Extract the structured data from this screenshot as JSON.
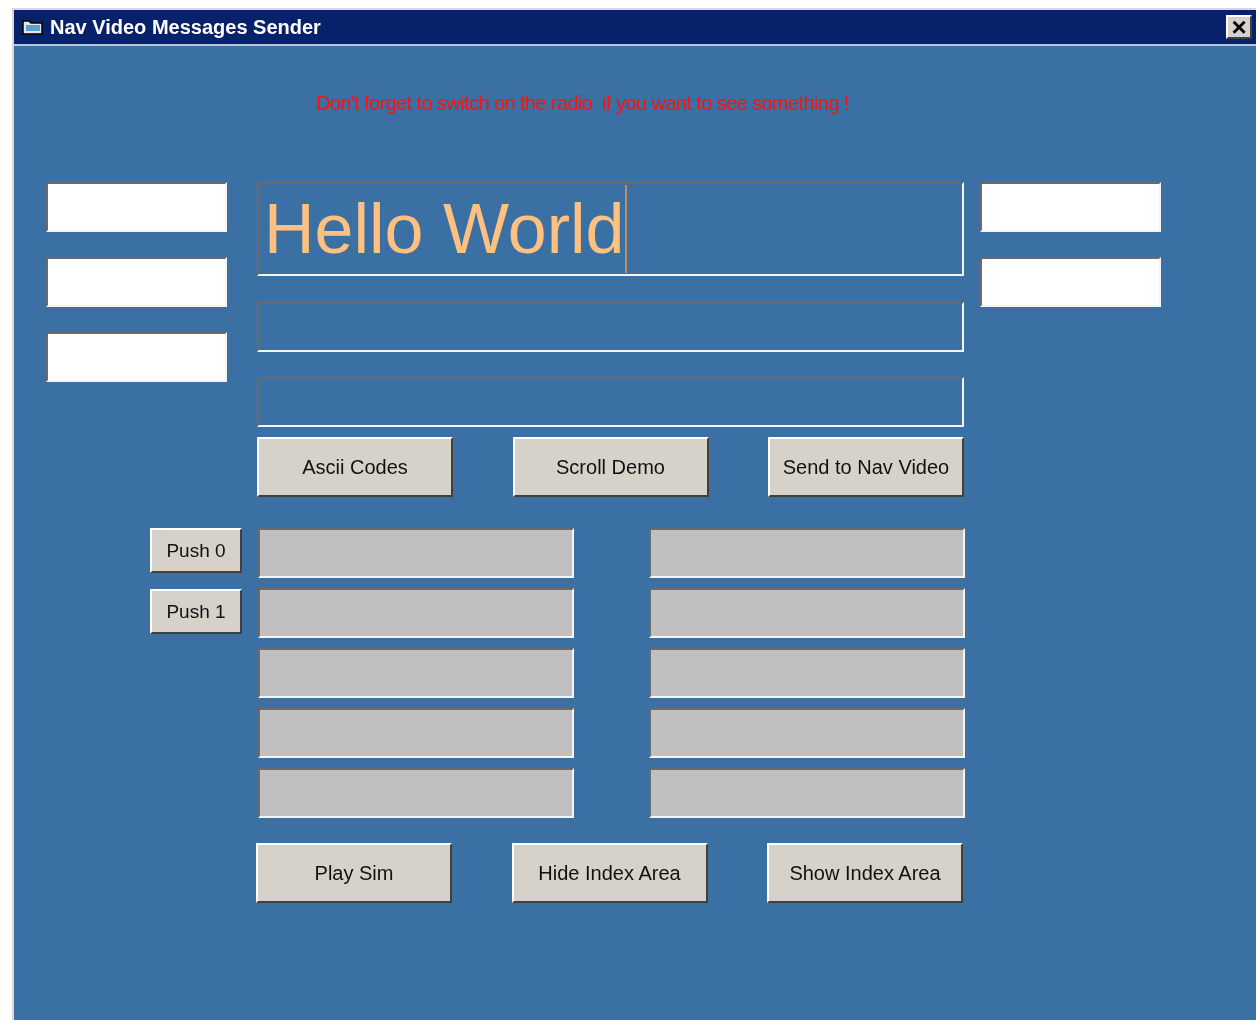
{
  "window": {
    "title": "Nav Video Messages Sender",
    "close": "×"
  },
  "warning": "Don't forget to switch on the radio  if you want to see something !",
  "left_fields": [
    {
      "kind": "entry"
    },
    {
      "kind": "entry"
    },
    {
      "kind": "entry"
    }
  ],
  "message_fields": [
    {
      "kind": "large",
      "value": "Hello World",
      "focused": true
    },
    {
      "kind": "plain"
    },
    {
      "kind": "plain"
    }
  ],
  "right_fields": [
    {
      "kind": "entry"
    },
    {
      "kind": "entry"
    }
  ],
  "action_buttons": [
    "Ascii Codes",
    "Scroll Demo",
    "Send to Nav Video"
  ],
  "push_buttons": [
    "Push 0",
    "Push 1"
  ],
  "index_fields_left": [
    {
      "kind": "display"
    },
    {
      "kind": "display"
    },
    {
      "kind": "display"
    },
    {
      "kind": "display"
    },
    {
      "kind": "display"
    }
  ],
  "index_fields_right": [
    {
      "kind": "display"
    },
    {
      "kind": "display"
    },
    {
      "kind": "display"
    },
    {
      "kind": "display"
    },
    {
      "kind": "display"
    }
  ],
  "bottom_buttons": [
    "Play Sim",
    "Hide Index Area",
    "Show Index Area"
  ]
}
